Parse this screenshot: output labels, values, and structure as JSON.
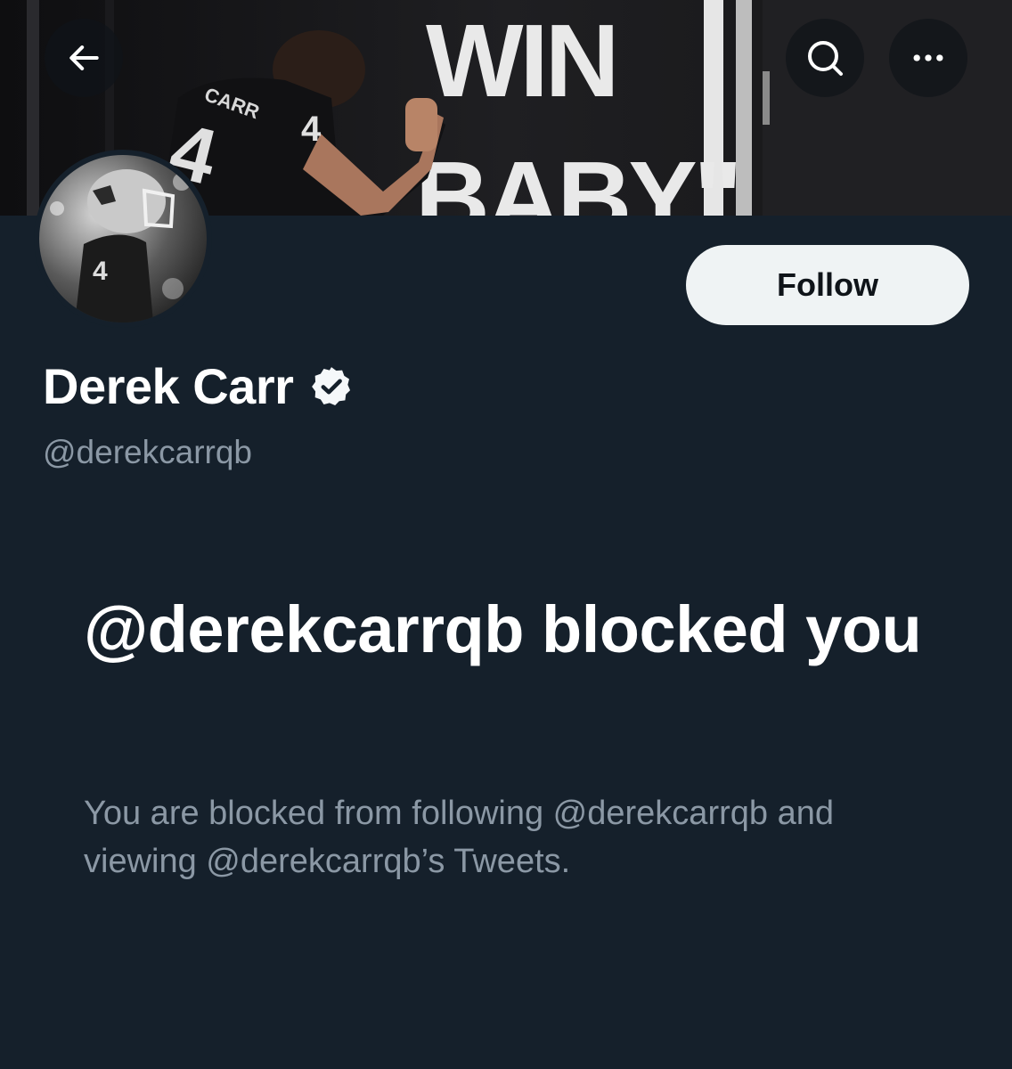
{
  "banner": {
    "wall_text_line1": "WIN",
    "wall_text_line2": "BABY\"",
    "jersey_name": "CARR",
    "jersey_number": "4"
  },
  "nav": {
    "back_icon": "arrow-left-icon",
    "search_icon": "search-icon",
    "more_icon": "more-horizontal-icon"
  },
  "avatar": {
    "jersey_number": "4"
  },
  "profile": {
    "name": "Derek Carr",
    "handle": "@derekcarrqb",
    "verified_icon": "verified-badge-icon"
  },
  "follow_button": {
    "label": "Follow"
  },
  "blocked": {
    "title": "@derekcarrqb blocked you",
    "description": "You are blocked from following @derekcarrqb and viewing @derekcarrqb’s Tweets."
  },
  "colors": {
    "background": "#15202b",
    "primary_text": "#ffffff",
    "secondary_text": "#8b98a5",
    "button_bg": "#eff3f4",
    "button_text": "#0f1419"
  }
}
